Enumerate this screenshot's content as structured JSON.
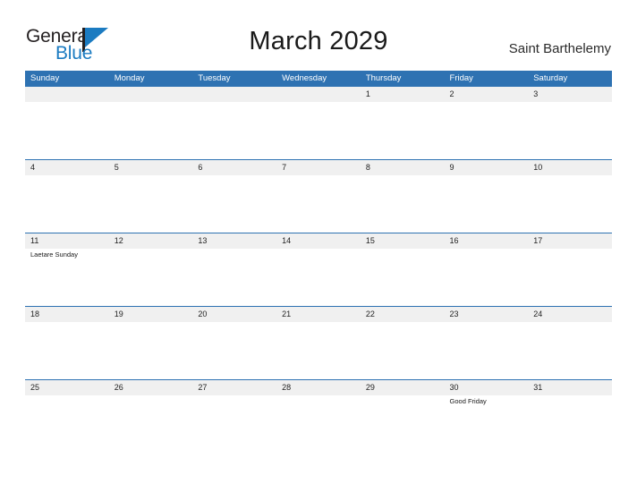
{
  "brand": {
    "name_part1": "General",
    "name_part2": "Blue",
    "colors": {
      "blue": "#1b7bc1",
      "dark": "#231f20"
    }
  },
  "header": {
    "title": "March 2029",
    "location": "Saint Barthelemy"
  },
  "calendar": {
    "colors": {
      "header_blue": "#2e72b2",
      "date_band": "#f0f0f0",
      "divider_blue": "#2e72b2"
    },
    "weekdays": [
      "Sunday",
      "Monday",
      "Tuesday",
      "Wednesday",
      "Thursday",
      "Friday",
      "Saturday"
    ],
    "weeks": [
      {
        "dates": [
          "",
          "",
          "",
          "",
          "1",
          "2",
          "3"
        ],
        "events": [
          "",
          "",
          "",
          "",
          "",
          "",
          ""
        ]
      },
      {
        "dates": [
          "4",
          "5",
          "6",
          "7",
          "8",
          "9",
          "10"
        ],
        "events": [
          "",
          "",
          "",
          "",
          "",
          "",
          ""
        ]
      },
      {
        "dates": [
          "11",
          "12",
          "13",
          "14",
          "15",
          "16",
          "17"
        ],
        "events": [
          "Laetare Sunday",
          "",
          "",
          "",
          "",
          "",
          ""
        ]
      },
      {
        "dates": [
          "18",
          "19",
          "20",
          "21",
          "22",
          "23",
          "24"
        ],
        "events": [
          "",
          "",
          "",
          "",
          "",
          "",
          ""
        ]
      },
      {
        "dates": [
          "25",
          "26",
          "27",
          "28",
          "29",
          "30",
          "31"
        ],
        "events": [
          "",
          "",
          "",
          "",
          "",
          "Good Friday",
          ""
        ]
      }
    ]
  }
}
